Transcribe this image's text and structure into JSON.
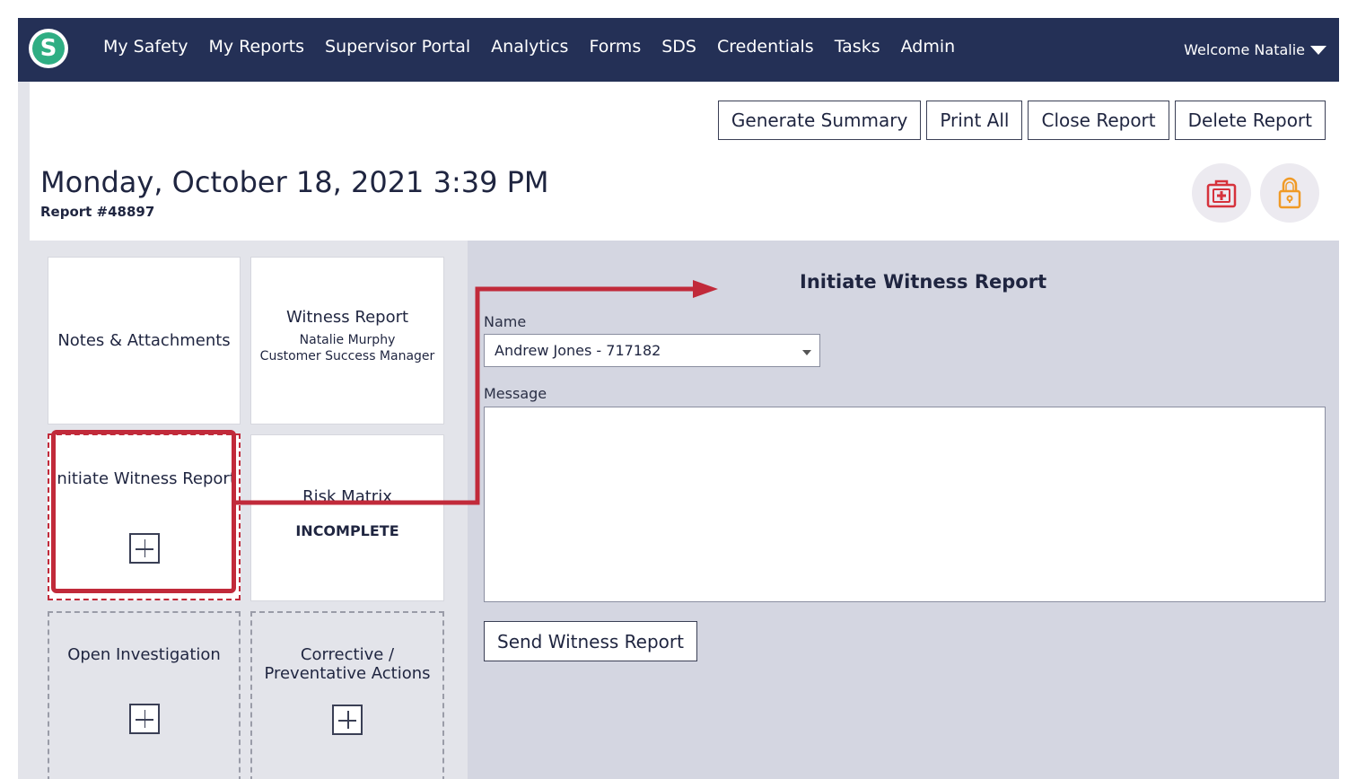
{
  "nav": {
    "logo_letter": "S",
    "items": [
      "My Safety",
      "My Reports",
      "Supervisor Portal",
      "Analytics",
      "Forms",
      "SDS",
      "Credentials",
      "Tasks",
      "Admin"
    ],
    "welcome": "Welcome Natalie"
  },
  "actions": {
    "generate_summary": "Generate Summary",
    "print_all": "Print All",
    "close_report": "Close Report",
    "delete_report": "Delete Report"
  },
  "header": {
    "title": "Monday, October 18, 2021 3:39 PM",
    "report_number": "Report #48897"
  },
  "icons": {
    "first_aid": "first-aid-kit-icon",
    "lock": "lock-icon",
    "first_aid_color": "#d6323c",
    "lock_color": "#f09a26"
  },
  "tiles": {
    "notes": "Notes & Attachments",
    "witness_report": {
      "title": "Witness Report",
      "name": "Natalie Murphy",
      "role": "Customer Success Manager"
    },
    "initiate_witness": "Initiate Witness Report",
    "risk_matrix": {
      "title": "Risk Matrix",
      "status": "INCOMPLETE"
    },
    "open_investigation": "Open Investigation",
    "corrective_line1": "Corrective /",
    "corrective_line2": "Preventative Actions"
  },
  "form": {
    "title": "Initiate Witness Report",
    "name_label": "Name",
    "name_value": "Andrew Jones - 717182",
    "message_label": "Message",
    "message_value": "",
    "send_button": "Send Witness Report"
  },
  "colors": {
    "nav_bg": "#243056",
    "highlight": "#c12a3a",
    "panel_bg": "#d4d6e1"
  }
}
